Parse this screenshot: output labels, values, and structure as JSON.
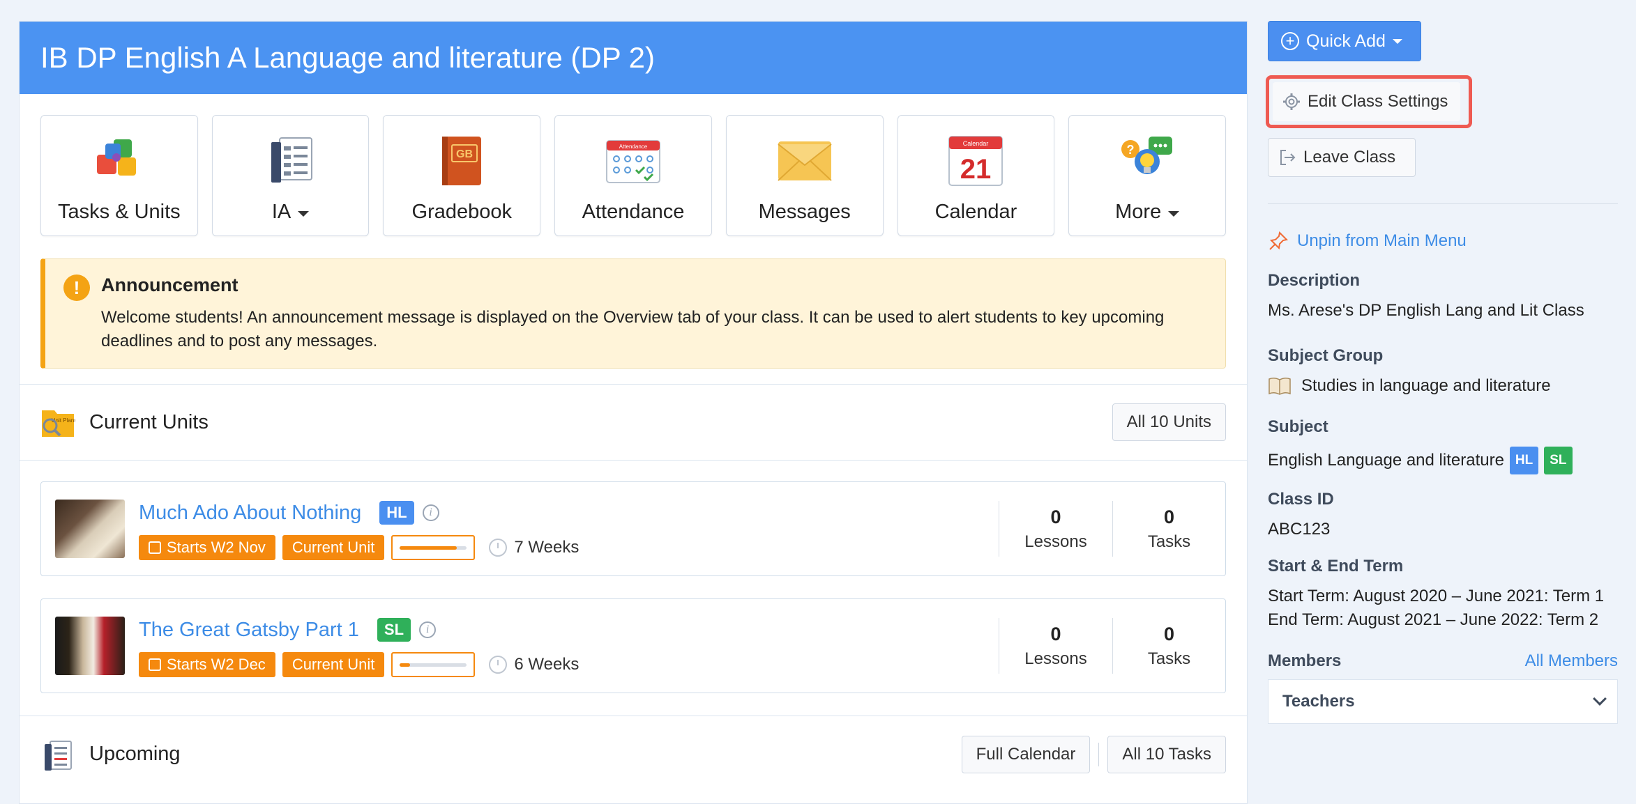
{
  "header": {
    "title": "IB DP English A Language and literature (DP 2)"
  },
  "tiles": [
    {
      "label": "Tasks & Units",
      "icon": "puzzle-icon",
      "dropdown": false
    },
    {
      "label": "IA",
      "icon": "ia-icon",
      "dropdown": true
    },
    {
      "label": "Gradebook",
      "icon": "gradebook-icon",
      "dropdown": false
    },
    {
      "label": "Attendance",
      "icon": "attendance-icon",
      "dropdown": false
    },
    {
      "label": "Messages",
      "icon": "envelope-icon",
      "dropdown": false
    },
    {
      "label": "Calendar",
      "icon": "calendar-icon",
      "dropdown": false
    },
    {
      "label": "More",
      "icon": "more-icon",
      "dropdown": true
    }
  ],
  "tile_icon_text": {
    "gradebook": "GB",
    "attendance": "Attendance",
    "calendar_header": "Calendar",
    "calendar_day": "21",
    "unit_plans": "Unit Plans"
  },
  "announcement": {
    "title": "Announcement",
    "text": "Welcome students! An announcement message is displayed on the Overview tab of your class. It can be used to alert students to key upcoming deadlines and to post any messages."
  },
  "current_units": {
    "title": "Current Units",
    "all_button": "All 10 Units",
    "units": [
      {
        "title": "Much Ado About Nothing",
        "level": "HL",
        "starts": "Starts W2 Nov",
        "status": "Current Unit",
        "progress": 0.85,
        "duration": "7 Weeks",
        "lessons_count": "0",
        "lessons_label": "Lessons",
        "tasks_count": "0",
        "tasks_label": "Tasks"
      },
      {
        "title": "The Great Gatsby Part 1",
        "level": "SL",
        "starts": "Starts W2 Dec",
        "status": "Current Unit",
        "progress": 0.15,
        "duration": "6 Weeks",
        "lessons_count": "0",
        "lessons_label": "Lessons",
        "tasks_count": "0",
        "tasks_label": "Tasks"
      }
    ]
  },
  "upcoming": {
    "title": "Upcoming",
    "calendar_button": "Full Calendar",
    "tasks_button": "All 10 Tasks"
  },
  "sidebar": {
    "quick_add": "Quick Add",
    "edit_settings": "Edit Class Settings",
    "leave_class": "Leave Class",
    "unpin": "Unpin from Main Menu",
    "description_label": "Description",
    "description": "Ms. Arese's DP English Lang and Lit Class",
    "subject_group_label": "Subject Group",
    "subject_group": "Studies in language and literature",
    "subject_label": "Subject",
    "subject": "English Language and literature",
    "subject_badges": [
      "HL",
      "SL"
    ],
    "class_id_label": "Class ID",
    "class_id": "ABC123",
    "term_label": "Start & End Term",
    "start_term": "Start Term: August 2020 – June 2021: Term 1",
    "end_term": "End Term: August 2021 – June 2022: Term 2",
    "members_label": "Members",
    "all_members": "All Members",
    "teachers": "Teachers"
  },
  "colors": {
    "header": "#4b93f2",
    "accent": "#f5890e",
    "hl": "#4a8ff0",
    "sl": "#2fb05a",
    "link": "#3d8ce6",
    "highlight_box": "#ee5a52"
  }
}
